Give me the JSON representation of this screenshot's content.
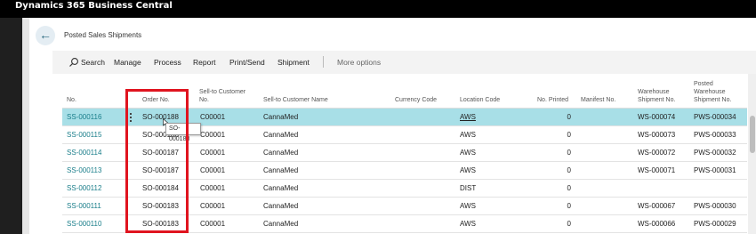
{
  "app": {
    "title": "Dynamics 365 Business Central"
  },
  "page": {
    "title": "Posted Sales Shipments",
    "back_icon": "back-arrow-icon"
  },
  "actions": {
    "search": "Search",
    "manage": "Manage",
    "process": "Process",
    "report": "Report",
    "print_send": "Print/Send",
    "shipment": "Shipment",
    "more_options": "More options"
  },
  "columns": {
    "no": "No.",
    "order_no": "Order No.",
    "sell_to_customer_no_1": "Sell-to Customer",
    "sell_to_customer_no_2": "No.",
    "sell_to_customer_name": "Sell-to Customer Name",
    "currency_code": "Currency Code",
    "location_code": "Location Code",
    "no_printed": "No. Printed",
    "manifest_no": "Manifest No.",
    "warehouse_shipment_no_1": "Warehouse",
    "warehouse_shipment_no_2": "Shipment No.",
    "posted_warehouse_1": "Posted",
    "posted_warehouse_2": "Warehouse",
    "posted_warehouse_3": "Shipment No."
  },
  "rows": [
    {
      "no": "SS-000116",
      "order_no": "SO-000188",
      "customer_no": "C00001",
      "customer_name": "CannaMed",
      "location": "AWS",
      "printed": "0",
      "wh_shipment": "WS-000074",
      "posted_wh_shipment": "PWS-000034"
    },
    {
      "no": "SS-000115",
      "order_no": "SO-000188",
      "customer_no": "C00001",
      "customer_name": "CannaMed",
      "location": "AWS",
      "printed": "0",
      "wh_shipment": "WS-000073",
      "posted_wh_shipment": "PWS-000033"
    },
    {
      "no": "SS-000114",
      "order_no": "SO-000187",
      "customer_no": "C00001",
      "customer_name": "CannaMed",
      "location": "AWS",
      "printed": "0",
      "wh_shipment": "WS-000072",
      "posted_wh_shipment": "PWS-000032"
    },
    {
      "no": "SS-000113",
      "order_no": "SO-000187",
      "customer_no": "C00001",
      "customer_name": "CannaMed",
      "location": "AWS",
      "printed": "0",
      "wh_shipment": "WS-000071",
      "posted_wh_shipment": "PWS-000031"
    },
    {
      "no": "SS-000112",
      "order_no": "SO-000184",
      "customer_no": "C00001",
      "customer_name": "CannaMed",
      "location": "DIST",
      "printed": "0",
      "wh_shipment": "",
      "posted_wh_shipment": ""
    },
    {
      "no": "SS-000111",
      "order_no": "SO-000183",
      "customer_no": "C00001",
      "customer_name": "CannaMed",
      "location": "AWS",
      "printed": "0",
      "wh_shipment": "WS-000067",
      "posted_wh_shipment": "PWS-000030"
    },
    {
      "no": "SS-000110",
      "order_no": "SO-000183",
      "customer_no": "C00001",
      "customer_name": "CannaMed",
      "location": "AWS",
      "printed": "0",
      "wh_shipment": "WS-000066",
      "posted_wh_shipment": "PWS-000029"
    }
  ],
  "tooltip": {
    "text": "SO-000188"
  },
  "colors": {
    "accent": "#1a7e8a",
    "selected_row": "#a8dfe7",
    "highlight_box": "#e0141f"
  }
}
